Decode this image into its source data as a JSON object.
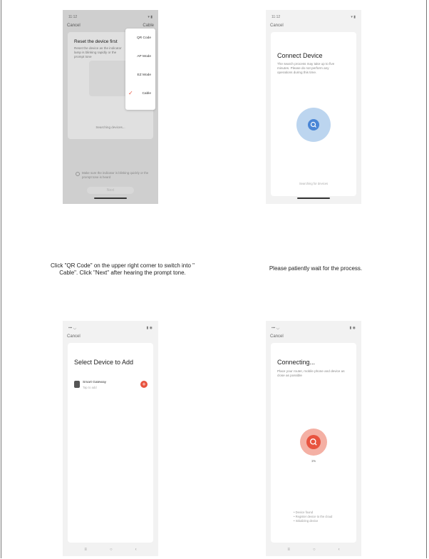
{
  "panel1": {
    "status_time": "11:12",
    "nav_cancel": "Cancel",
    "nav_mode": "Cable",
    "card_title": "Reset the device first",
    "card_desc": "Reset the device as the indicator lamp is blinking rapidly or the prompt tone",
    "searching": "Searching devices...",
    "checkbox_text": "Make sure the indicator is blinking quickly or the prompt tone is heard",
    "next_label": "Next",
    "menu": [
      "QR Code",
      "AP Mode",
      "EZ Mode",
      "Cable"
    ],
    "menu_selected": "Cable",
    "checkmark": "✓"
  },
  "panel2": {
    "status_time": "11:12",
    "nav_cancel": "Cancel",
    "card_title": "Connect Device",
    "card_desc": "The search process may take up to five minutes. Please do not perform any operations during this time.",
    "footer": "Searching for devices"
  },
  "panel3": {
    "nav_cancel": "Cancel",
    "card_title": "Select Device to Add",
    "device_name": "Smart Gateway",
    "device_sub": "Tap to add",
    "add_icon": "+"
  },
  "panel4": {
    "nav_cancel": "Cancel",
    "card_title": "Connecting...",
    "card_desc": "Place your router, mobile phone and device as close as possible",
    "percent": "1%",
    "steps": [
      "Device found",
      "Register device to the cloud",
      "Initializing device"
    ]
  },
  "captions": {
    "left": "Click \"QR Code\" on the upper right corner to switch into \" Cable\". Click \"Next\" after hearing the prompt tone.",
    "right": "Please patiently wait for the process."
  },
  "android_nav": [
    "≡",
    "○",
    "‹"
  ],
  "colors": {
    "accent_blue": "#4a86d6",
    "blue_halo": "#bcd5ef",
    "accent_red": "#e8533f",
    "red_halo": "#f4b0a4",
    "check_red": "#e8533f"
  }
}
